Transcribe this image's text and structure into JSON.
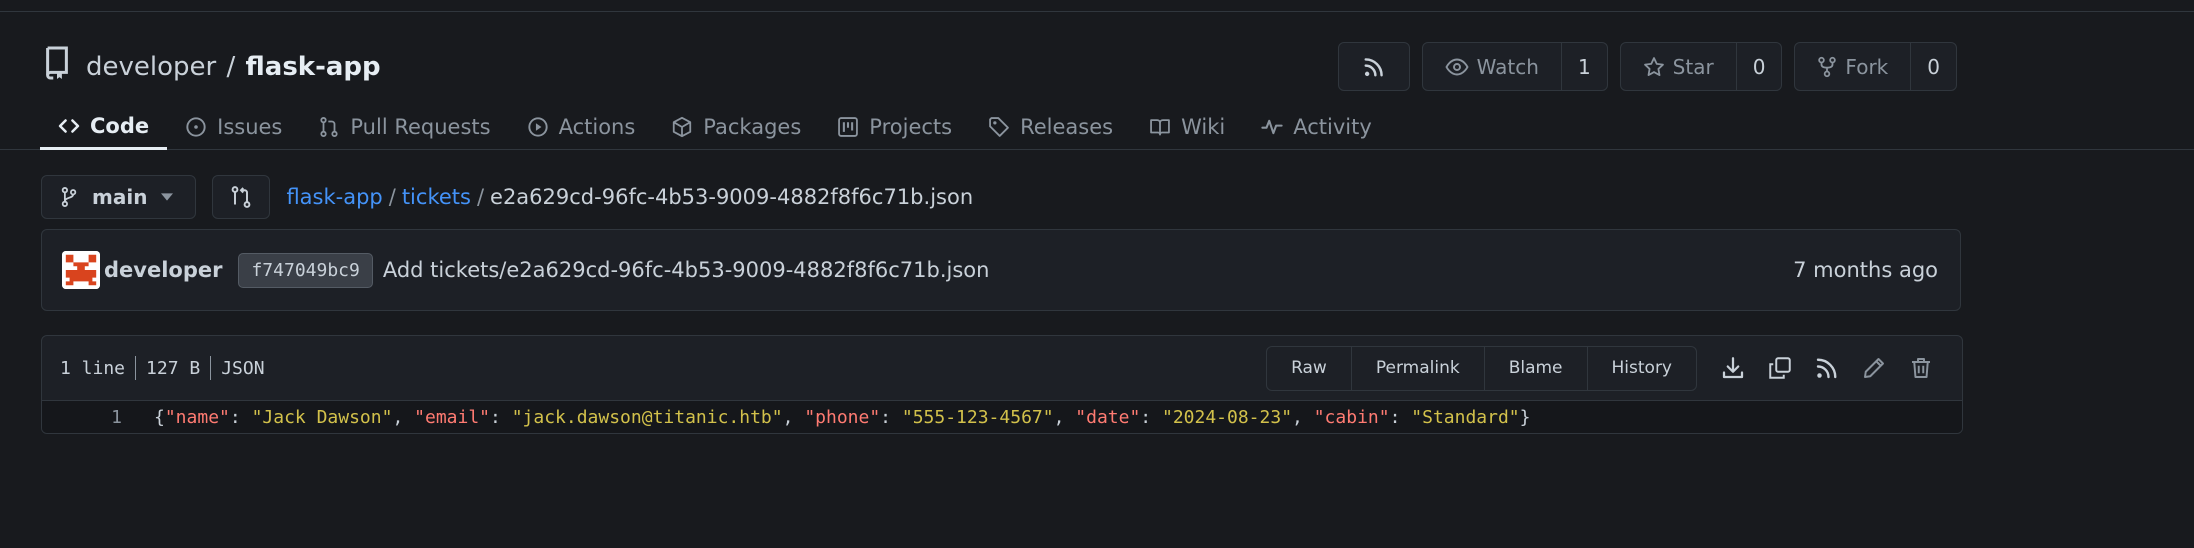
{
  "repo": {
    "owner": "developer",
    "separator": "/",
    "name": "flask-app"
  },
  "actions": {
    "watch_label": "Watch",
    "watch_count": "1",
    "star_label": "Star",
    "star_count": "0",
    "fork_label": "Fork",
    "fork_count": "0"
  },
  "tabs": [
    {
      "label": "Code",
      "icon": "code-icon",
      "active": true
    },
    {
      "label": "Issues",
      "icon": "issue-icon"
    },
    {
      "label": "Pull Requests",
      "icon": "pull-request-icon"
    },
    {
      "label": "Actions",
      "icon": "play-icon"
    },
    {
      "label": "Packages",
      "icon": "package-icon"
    },
    {
      "label": "Projects",
      "icon": "project-icon"
    },
    {
      "label": "Releases",
      "icon": "tag-icon"
    },
    {
      "label": "Wiki",
      "icon": "book-icon"
    },
    {
      "label": "Activity",
      "icon": "pulse-icon"
    }
  ],
  "branch": {
    "name": "main"
  },
  "breadcrumb": {
    "root": "flask-app",
    "folder": "tickets",
    "sep": "/",
    "file": "e2a629cd-96fc-4b53-9009-4882f8f6c71b.json"
  },
  "commit": {
    "author": "developer",
    "sha": "f747049bc9",
    "message": "Add tickets/e2a629cd-96fc-4b53-9009-4882f8f6c71b.json",
    "time": "7 months ago"
  },
  "file": {
    "lines": "1 line",
    "size": "127 B",
    "type": "JSON",
    "view_buttons": [
      "Raw",
      "Permalink",
      "Blame",
      "History"
    ],
    "line_number": "1",
    "content": {
      "open": "{",
      "pairs": [
        {
          "key": "\"name\"",
          "value": "\"Jack Dawson\""
        },
        {
          "key": "\"email\"",
          "value": "\"jack.dawson@titanic.htb\""
        },
        {
          "key": "\"phone\"",
          "value": "\"555-123-4567\""
        },
        {
          "key": "\"date\"",
          "value": "\"2024-08-23\""
        },
        {
          "key": "\"cabin\"",
          "value": "\"Standard\""
        }
      ],
      "close": "}"
    }
  },
  "colors": {
    "background": "#181a1e",
    "link": "#4493f8",
    "json_key": "#ff7b72",
    "json_string": "#d2c14b"
  }
}
